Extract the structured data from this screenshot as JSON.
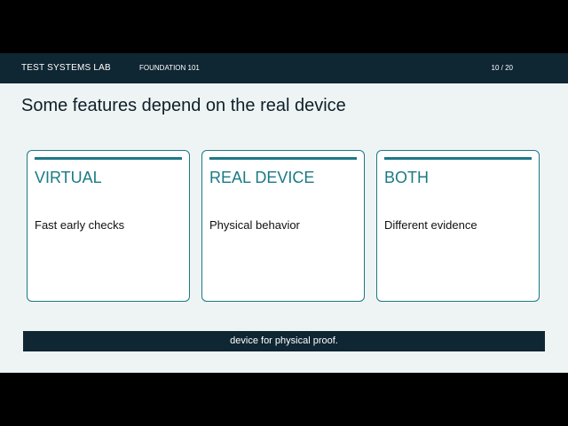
{
  "header": {
    "brand": "TEST SYSTEMS LAB",
    "course": "FOUNDATION 101",
    "page": "10 / 20"
  },
  "slide": {
    "title": "Some features depend on the real device",
    "cards": [
      {
        "title": "VIRTUAL",
        "body": "Fast early checks"
      },
      {
        "title": "REAL DEVICE",
        "body": "Physical behavior"
      },
      {
        "title": "BOTH",
        "body": "Different evidence"
      }
    ]
  },
  "caption": "device for physical proof.",
  "colors": {
    "bar": "#0f2633",
    "accent": "#1a7a85",
    "slide_bg": "#eef4f4"
  }
}
